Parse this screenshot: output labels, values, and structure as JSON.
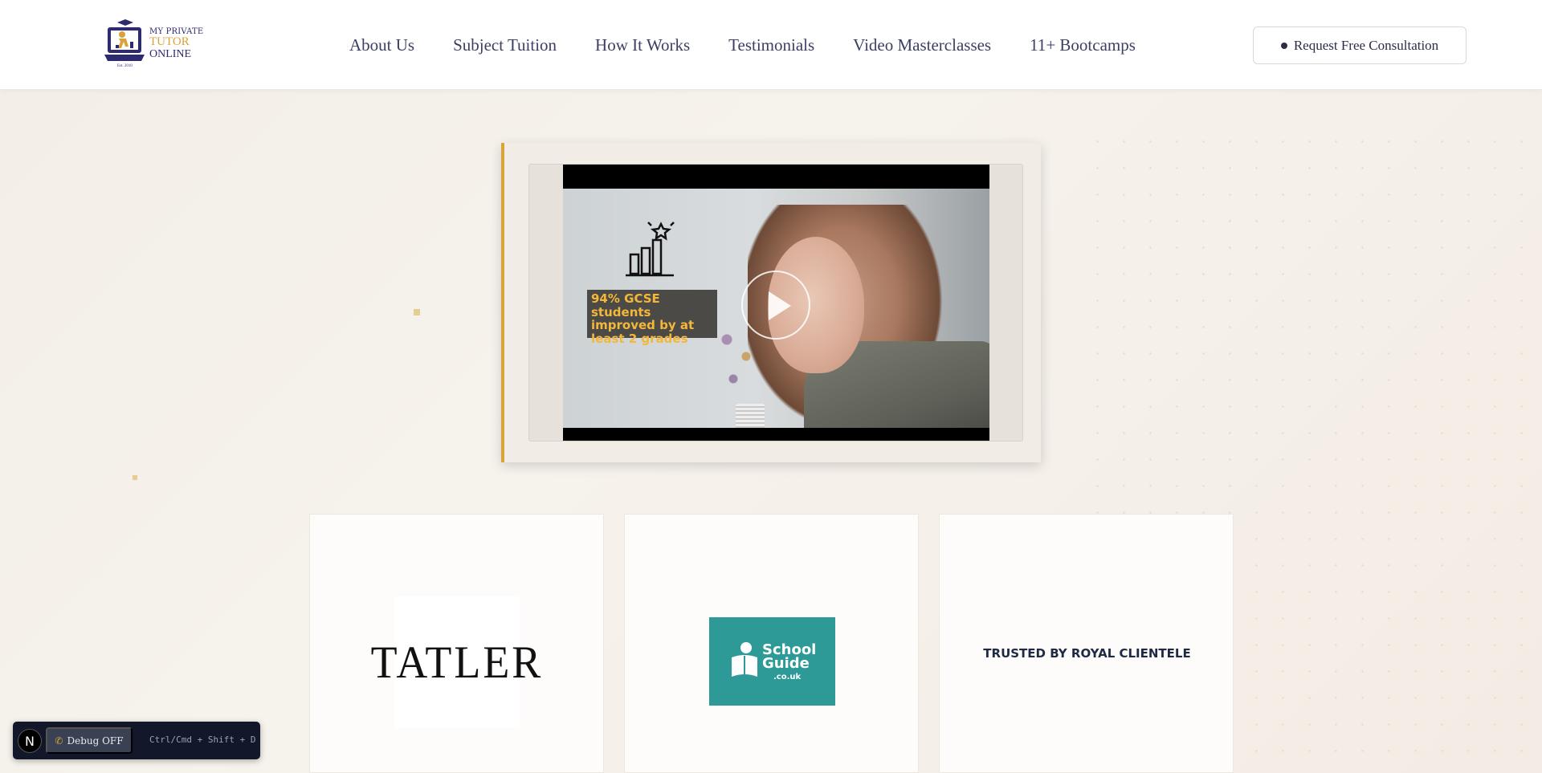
{
  "header": {
    "logo": {
      "line1": "MY PRIVATE",
      "line2": "TUTOR",
      "line3": "ONLINE",
      "est": "Est. 2010",
      "icon": "laptop-graduate-icon"
    },
    "nav": [
      {
        "label": "About Us"
      },
      {
        "label": "Subject Tuition"
      },
      {
        "label": "How It Works"
      },
      {
        "label": "Testimonials"
      },
      {
        "label": "Video Masterclasses"
      },
      {
        "label": "11+ Bootcamps"
      }
    ],
    "cta_label": "Request Free Consultation"
  },
  "video": {
    "stat_text": "94% GCSE students improved by at least 2 grades",
    "play_icon": "play-icon",
    "chart_icon": "bar-chart-star-icon"
  },
  "press": [
    {
      "type": "logo",
      "text": "TATLER"
    },
    {
      "type": "logo",
      "text_1": "School",
      "text_2": "Guide",
      "text_3": ".co.uk"
    },
    {
      "type": "text",
      "text": "TRUSTED BY ROYAL CLIENTELE"
    }
  ],
  "debug": {
    "logo_letter": "N",
    "button_label": "Debug OFF",
    "shortcut_hint": "Ctrl/Cmd + Shift + D"
  },
  "colors": {
    "accent_gold": "#d9a53b",
    "brand_navy": "#2d2a6e",
    "school_guide_teal": "#2d9a98"
  }
}
